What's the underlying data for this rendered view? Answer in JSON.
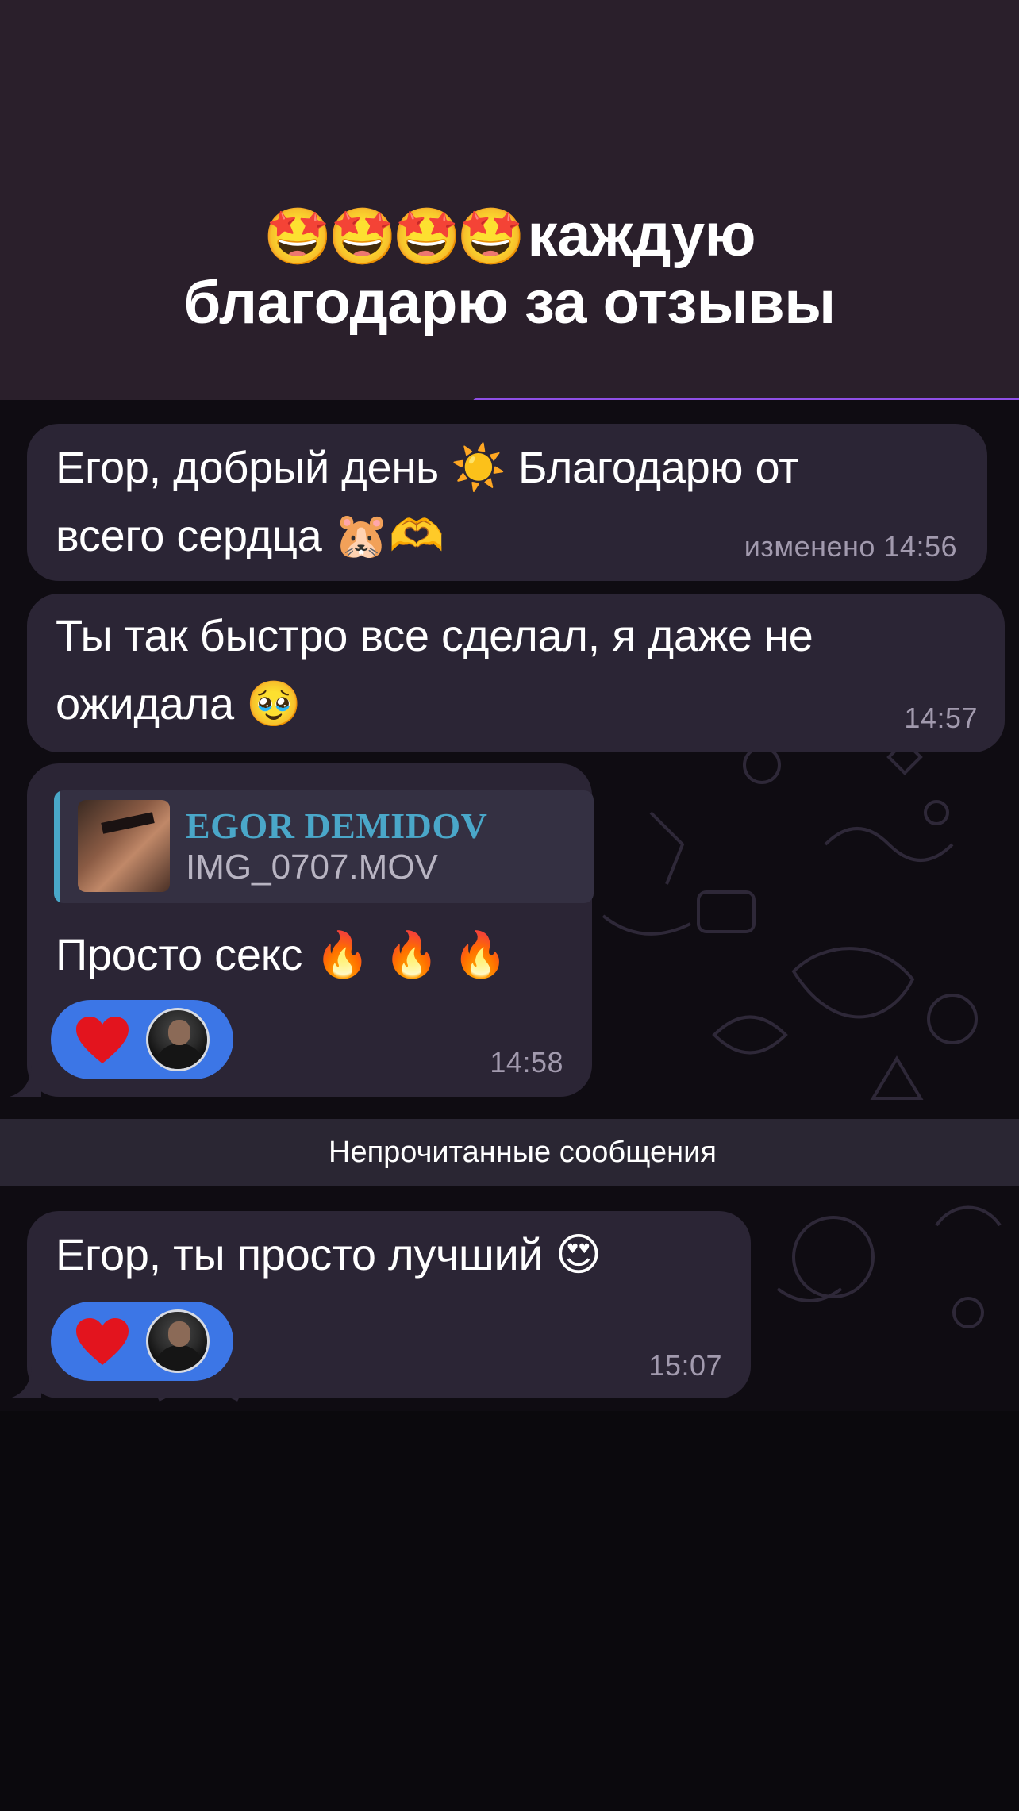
{
  "header": {
    "title_emoji": "🤩🤩🤩🤩",
    "title_line1": "каждую",
    "title_line2": "благодарю за отзывы"
  },
  "messages": [
    {
      "line1": "Егор, добрый день",
      "line1_emoji": "☀️",
      "line1_rest": "Благодарю от",
      "line2": "всего сердца",
      "line2_emoji": "🐹🫶",
      "time": "изменено 14:56"
    },
    {
      "line1": "Ты так быстро все сделал, я даже не",
      "line2": "ожидала",
      "line2_emoji": "🥹",
      "time": "14:57"
    },
    {
      "reply_name": "EGOR DEMIDOV",
      "reply_file": "IMG_0707.MOV",
      "text": "Просто секс",
      "text_emoji": "🔥 🔥 🔥",
      "reaction": "❤️",
      "time": "14:58"
    },
    {
      "text": "Егор, ты просто лучший",
      "text_emoji": "😍",
      "reaction": "❤️",
      "time": "15:07"
    }
  ],
  "unread_label": "Непрочитанные сообщения",
  "icons": {
    "reaction": "heart-icon",
    "reactor": "avatar"
  },
  "colors": {
    "header_bg": "#2a1f2b",
    "bubble_bg": "#2b2535",
    "reaction_bg": "#3c76e6",
    "reply_accent": "#49a7c8",
    "progress": "#8f4fe6"
  }
}
